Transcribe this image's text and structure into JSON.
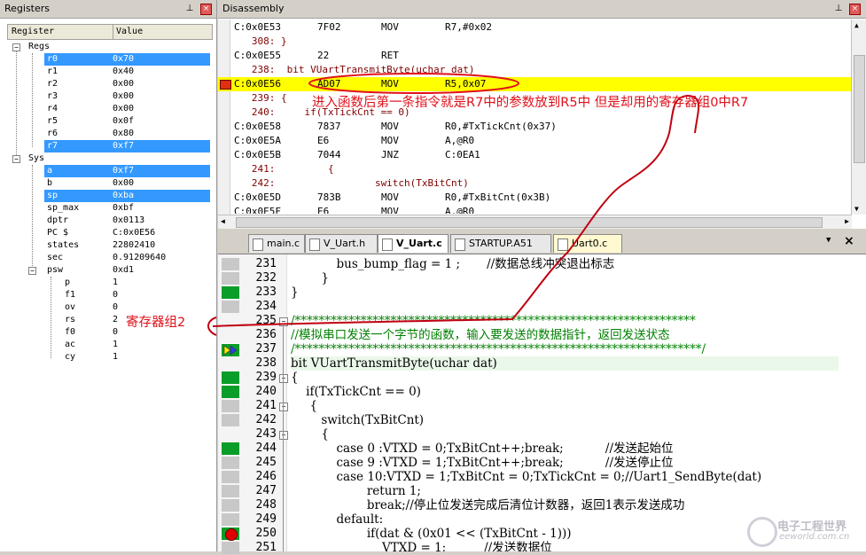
{
  "registers": {
    "title": "Registers",
    "col_register": "Register",
    "col_value": "Value",
    "groups": [
      {
        "name": "Regs",
        "items": [
          {
            "name": "r0",
            "value": "0x70",
            "selected": true
          },
          {
            "name": "r1",
            "value": "0x40",
            "selected": false
          },
          {
            "name": "r2",
            "value": "0x00",
            "selected": false
          },
          {
            "name": "r3",
            "value": "0x00",
            "selected": false
          },
          {
            "name": "r4",
            "value": "0x00",
            "selected": false
          },
          {
            "name": "r5",
            "value": "0x0f",
            "selected": false
          },
          {
            "name": "r6",
            "value": "0x80",
            "selected": false
          },
          {
            "name": "r7",
            "value": "0xf7",
            "selected": true
          }
        ]
      },
      {
        "name": "Sys",
        "items": [
          {
            "name": "a",
            "value": "0xf7",
            "selected": true
          },
          {
            "name": "b",
            "value": "0x00",
            "selected": false
          },
          {
            "name": "sp",
            "value": "0xba",
            "selected": true
          },
          {
            "name": "sp_max",
            "value": "0xbf",
            "selected": false
          },
          {
            "name": "dptr",
            "value": "0x0113",
            "selected": false
          },
          {
            "name": "PC  $",
            "value": "C:0x0E56",
            "selected": false
          },
          {
            "name": "states",
            "value": "22802410",
            "selected": false
          },
          {
            "name": "sec",
            "value": "0.91209640",
            "selected": false
          },
          {
            "name": "psw",
            "value": "0xd1",
            "selected": false
          }
        ]
      },
      {
        "name": "psw_bits",
        "items": [
          {
            "name": "p",
            "value": "1"
          },
          {
            "name": "f1",
            "value": "0"
          },
          {
            "name": "ov",
            "value": "0"
          },
          {
            "name": "rs",
            "value": "2"
          },
          {
            "name": "f0",
            "value": "0"
          },
          {
            "name": "ac",
            "value": "1"
          },
          {
            "name": "cy",
            "value": "1"
          }
        ]
      }
    ]
  },
  "disassembly": {
    "title": "Disassembly",
    "lines": [
      {
        "addr": "C:0x0E53",
        "code": "7F02",
        "op": "MOV",
        "args": "R7,#0x02",
        "src": ""
      },
      {
        "addr": "",
        "code": "",
        "op": "",
        "args": "",
        "src": "   308: }"
      },
      {
        "addr": "C:0x0E55",
        "code": "22",
        "op": "RET",
        "args": "",
        "src": ""
      },
      {
        "addr": "",
        "code": "",
        "op": "",
        "args": "",
        "src": "   238:  bit VUartTransmitByte(uchar dat)"
      },
      {
        "addr": "C:0x0E56",
        "code": "AD07",
        "op": "MOV",
        "args": "R5,0x07",
        "src": ""
      },
      {
        "addr": "",
        "code": "",
        "op": "",
        "args": "",
        "src": "   239: {"
      },
      {
        "addr": "",
        "code": "",
        "op": "",
        "args": "",
        "src": "   240:     if(TxTickCnt == 0)"
      },
      {
        "addr": "C:0x0E58",
        "code": "7837",
        "op": "MOV",
        "args": "R0,#TxTickCnt(0x37)",
        "src": ""
      },
      {
        "addr": "C:0x0E5A",
        "code": "E6",
        "op": "MOV",
        "args": "A,@R0",
        "src": ""
      },
      {
        "addr": "C:0x0E5B",
        "code": "7044",
        "op": "JNZ",
        "args": "C:0EA1",
        "src": ""
      },
      {
        "addr": "",
        "code": "",
        "op": "",
        "args": "",
        "src": "   241:         {"
      },
      {
        "addr": "",
        "code": "",
        "op": "",
        "args": "",
        "src": "   242:                 switch(TxBitCnt)"
      },
      {
        "addr": "C:0x0E5D",
        "code": "783B",
        "op": "MOV",
        "args": "R0,#TxBitCnt(0x3B)",
        "src": ""
      },
      {
        "addr": "C:0x0E5F",
        "code": "E6",
        "op": "MOV",
        "args": "A,@R0",
        "src": ""
      }
    ]
  },
  "tabs": [
    {
      "label": "main.c",
      "active": false
    },
    {
      "label": "V_Uart.h",
      "active": false
    },
    {
      "label": "V_Uart.c",
      "active": true
    },
    {
      "label": "STARTUP.A51",
      "active": false
    },
    {
      "label": "Uart0.c",
      "active": false
    }
  ],
  "source": {
    "lines": [
      {
        "no": "231",
        "text": "            bus_bump_flag = 1 ;       //数据总线冲突退出标志"
      },
      {
        "no": "232",
        "text": "        }"
      },
      {
        "no": "233",
        "text": "}"
      },
      {
        "no": "234",
        "text": ""
      },
      {
        "no": "235",
        "text": "/*******************************************************************"
      },
      {
        "no": "236",
        "text": "//模拟串口发送一个字节的函数，输入要发送的数据指针，返回发送状态"
      },
      {
        "no": "237",
        "text": "/********************************************************************/"
      },
      {
        "no": "238",
        "text": "bit VUartTransmitByte(uchar dat)"
      },
      {
        "no": "239",
        "text": "{"
      },
      {
        "no": "240",
        "text": "    if(TxTickCnt == 0)"
      },
      {
        "no": "241",
        "text": "     {"
      },
      {
        "no": "242",
        "text": "        switch(TxBitCnt)"
      },
      {
        "no": "243",
        "text": "        {"
      },
      {
        "no": "244",
        "text": "            case 0 :VTXD = 0;TxBitCnt++;break;           //发送起始位"
      },
      {
        "no": "245",
        "text": "            case 9 :VTXD = 1;TxBitCnt++;break;           //发送停止位"
      },
      {
        "no": "246",
        "text": "            case 10:VTXD = 1;TxBitCnt = 0;TxTickCnt = 0;//Uart1_SendByte(dat)"
      },
      {
        "no": "247",
        "text": "                    return 1;"
      },
      {
        "no": "248",
        "text": "                    break;//停止位发送完成后清位计数器，返回1表示发送成功"
      },
      {
        "no": "249",
        "text": "            default:"
      },
      {
        "no": "250",
        "text": "                    if(dat & (0x01 << (TxBitCnt - 1)))"
      },
      {
        "no": "251",
        "text": "                        VTXD = 1;          //发送数据位"
      }
    ]
  },
  "annotations": {
    "note_top": "进入函数后第一条指令就是R7中的参数放到R5中 但是却用的寄存器组0中R7",
    "note_left": "寄存器组2"
  },
  "watermark": {
    "text": "电子工程世界",
    "url": "eeworld.com.cn"
  },
  "colors": {
    "selected_row": "#3399ff",
    "current_line": "#ffff00",
    "annotation": "#e0101a",
    "coverage_green": "#0a9d2a",
    "keyword": "#0000ff",
    "comment": "#008000"
  }
}
